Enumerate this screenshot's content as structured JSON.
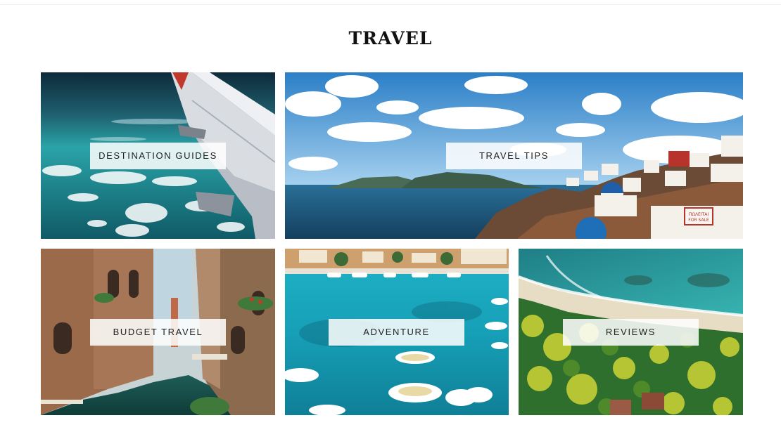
{
  "page": {
    "title": "TRAVEL"
  },
  "tiles": [
    {
      "label": "DESTINATION GUIDES",
      "image": "airplane-wing-over-ocean"
    },
    {
      "label": "TRAVEL TIPS",
      "image": "santorini-coast"
    },
    {
      "label": "BUDGET TRAVEL",
      "image": "venice-canal"
    },
    {
      "label": "ADVENTURE",
      "image": "harbor-boats"
    },
    {
      "label": "REVIEWS",
      "image": "tropical-beach-aerial"
    }
  ]
}
